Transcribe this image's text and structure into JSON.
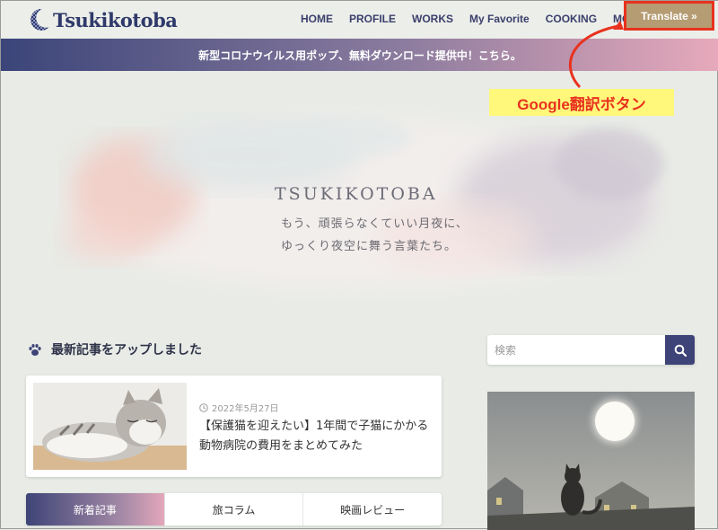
{
  "header": {
    "logo_text": "Tsukikotoba",
    "nav": [
      "HOME",
      "PROFILE",
      "WORKS",
      "My Favorite",
      "COOKING",
      "MOVIES"
    ],
    "translate_label": "Translate »"
  },
  "announcement": "新型コロナウイルス用ポップ、無料ダウンロード提供中！こちら。",
  "callout": "Google翻訳ボタン",
  "hero": {
    "title": "TSUKIKOTOBA",
    "line1": "もう、頑張らなくていい月夜に、",
    "line2": "ゆっくり夜空に舞う言葉たち。"
  },
  "section": {
    "title": "最新記事をアップしました"
  },
  "post": {
    "date": "2022年5月27日",
    "title": "【保護猫を迎えたい】1年間で子猫にかかる動物病院の費用をまとめてみた"
  },
  "tabs": [
    "新着記事",
    "旅コラム",
    "映画レビュー"
  ],
  "sidebar": {
    "search_placeholder": "検索"
  },
  "colors": {
    "brand": "#3e4477",
    "accent_red": "#e8321e",
    "callout_bg": "#fff87a",
    "translate_bg": "#b59c72"
  }
}
